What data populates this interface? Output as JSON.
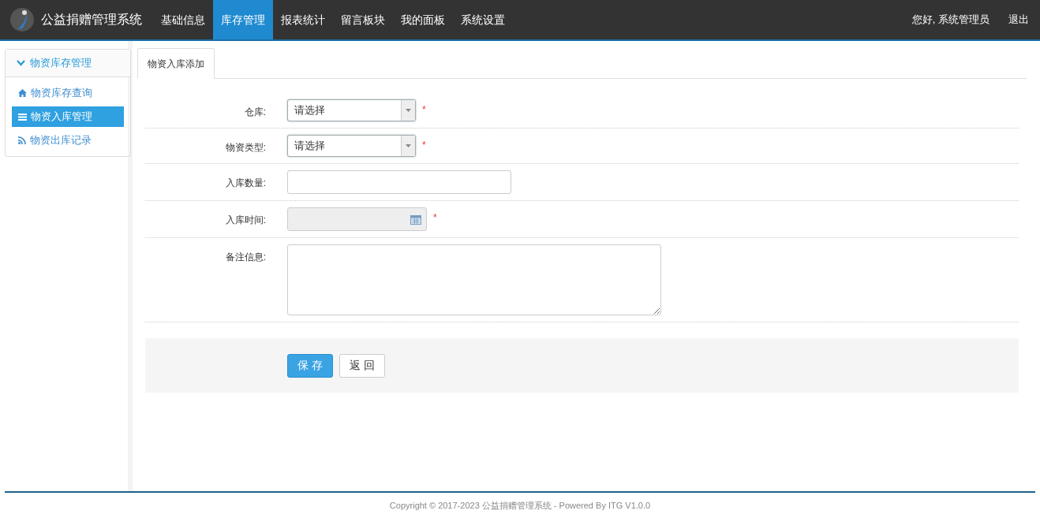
{
  "header": {
    "title": "公益捐赠管理系统",
    "nav": [
      {
        "label": "基础信息",
        "selected": false
      },
      {
        "label": "库存管理",
        "selected": true
      },
      {
        "label": "报表统计",
        "selected": false
      },
      {
        "label": "留言板块",
        "selected": false
      },
      {
        "label": "我的面板",
        "selected": false
      },
      {
        "label": "系统设置",
        "selected": false
      }
    ],
    "greeting": "您好, 系统管理员",
    "logout": "退出"
  },
  "sidebar": {
    "title": "物资库存管理",
    "expanded": true,
    "items": [
      {
        "label": "物资库存查询",
        "kind": "home",
        "selected": false
      },
      {
        "label": "物资入库管理",
        "kind": "list",
        "selected": true
      },
      {
        "label": "物资出库记录",
        "kind": "feed",
        "selected": false
      }
    ]
  },
  "tab": {
    "label": "物资入库添加",
    "selected": true
  },
  "form": {
    "fields": [
      {
        "label": "仓库:",
        "kind": "select",
        "value": "请选择",
        "required_mark": "*"
      },
      {
        "label": "物资类型:",
        "kind": "select",
        "value": "请选择",
        "required_mark": "*"
      },
      {
        "label": "入库数量:",
        "kind": "text"
      },
      {
        "label": "入库时间:",
        "kind": "date",
        "required_mark": "*",
        "disabled": true
      },
      {
        "label": "备注信息:",
        "kind": "textarea"
      }
    ],
    "buttons": [
      {
        "label": "保 存",
        "kind": "primary"
      },
      {
        "label": "返 回",
        "kind": "default"
      }
    ]
  },
  "footer": "Copyright © 2017-2023 公益捐赠管理系统 - Powered By ITG V1.0.0"
}
